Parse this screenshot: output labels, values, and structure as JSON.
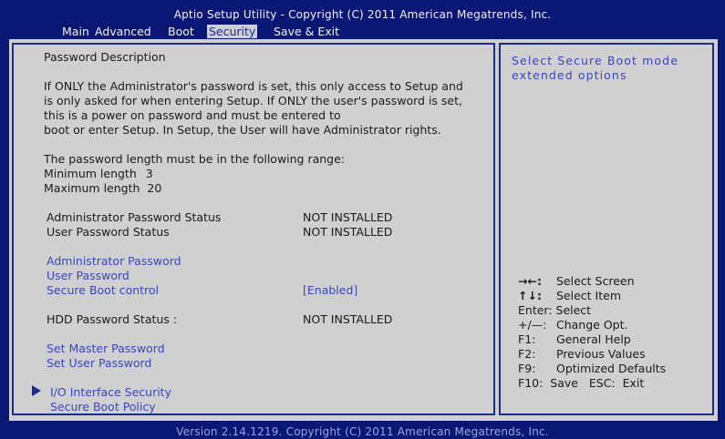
{
  "title": "Aptio Setup Utility - Copyright (C) 2011 American Megatrends, Inc.",
  "menu": {
    "main": "Main",
    "advanced": "Advanced",
    "boot": "Boot",
    "security": "Security",
    "save_exit": "Save & Exit"
  },
  "description": {
    "heading": "Password Description",
    "p1_l1": "If ONLY the Administrator's password is set, this only access to Setup and",
    "p1_l2": "is only asked for when entering Setup. If ONLY the user's password is set,",
    "p1_l3": "this is a power on password and must be entered to",
    "p1_l4": "boot or enter Setup. In Setup, the User will have Administrator rights.",
    "p2_l1": "The password length must be in the following range:",
    "min_label": "Minimum length",
    "min_value": "3",
    "max_label": "Maximum length",
    "max_value": "20"
  },
  "status": {
    "admin_label": "Administrator Password Status",
    "admin_value": "NOT INSTALLED",
    "user_label": "User Password Status",
    "user_value": "NOT INSTALLED"
  },
  "items": {
    "admin_password": "Administrator Password",
    "user_password": "User Password",
    "secure_boot_control": "Secure Boot control",
    "secure_boot_value": "[Enabled]",
    "hdd_status_label": "HDD Password Status :",
    "hdd_status_value": "NOT INSTALLED",
    "set_master": "Set Master Password",
    "set_user": "Set User Password",
    "io_security": "I/O Interface Security",
    "secure_boot_policy": "Secure Boot Policy"
  },
  "help_text": "Select Secure Boot mode extended options",
  "legend": {
    "select_screen_key": "→←:",
    "select_screen": "Select Screen",
    "select_item_key": "↑↓:",
    "select_item": "Select Item",
    "enter": "Enter: Select",
    "change_key": "+/—:",
    "change": "Change Opt.",
    "f1_key": "F1:",
    "f1": "General Help",
    "f2_key": "F2:",
    "f2": "Previous Values",
    "f9_key": "F9:",
    "f9": "Optimized Defaults",
    "f10": "F10:  Save   ESC:  Exit"
  },
  "footer": "Version 2.14.1219. Copyright (C) 2011 American Megatrends, Inc.",
  "colors": {
    "background": "#0b1775",
    "panel": "#d0d0d0",
    "accent": "#3a46b8",
    "text": "#1a1a1a"
  }
}
